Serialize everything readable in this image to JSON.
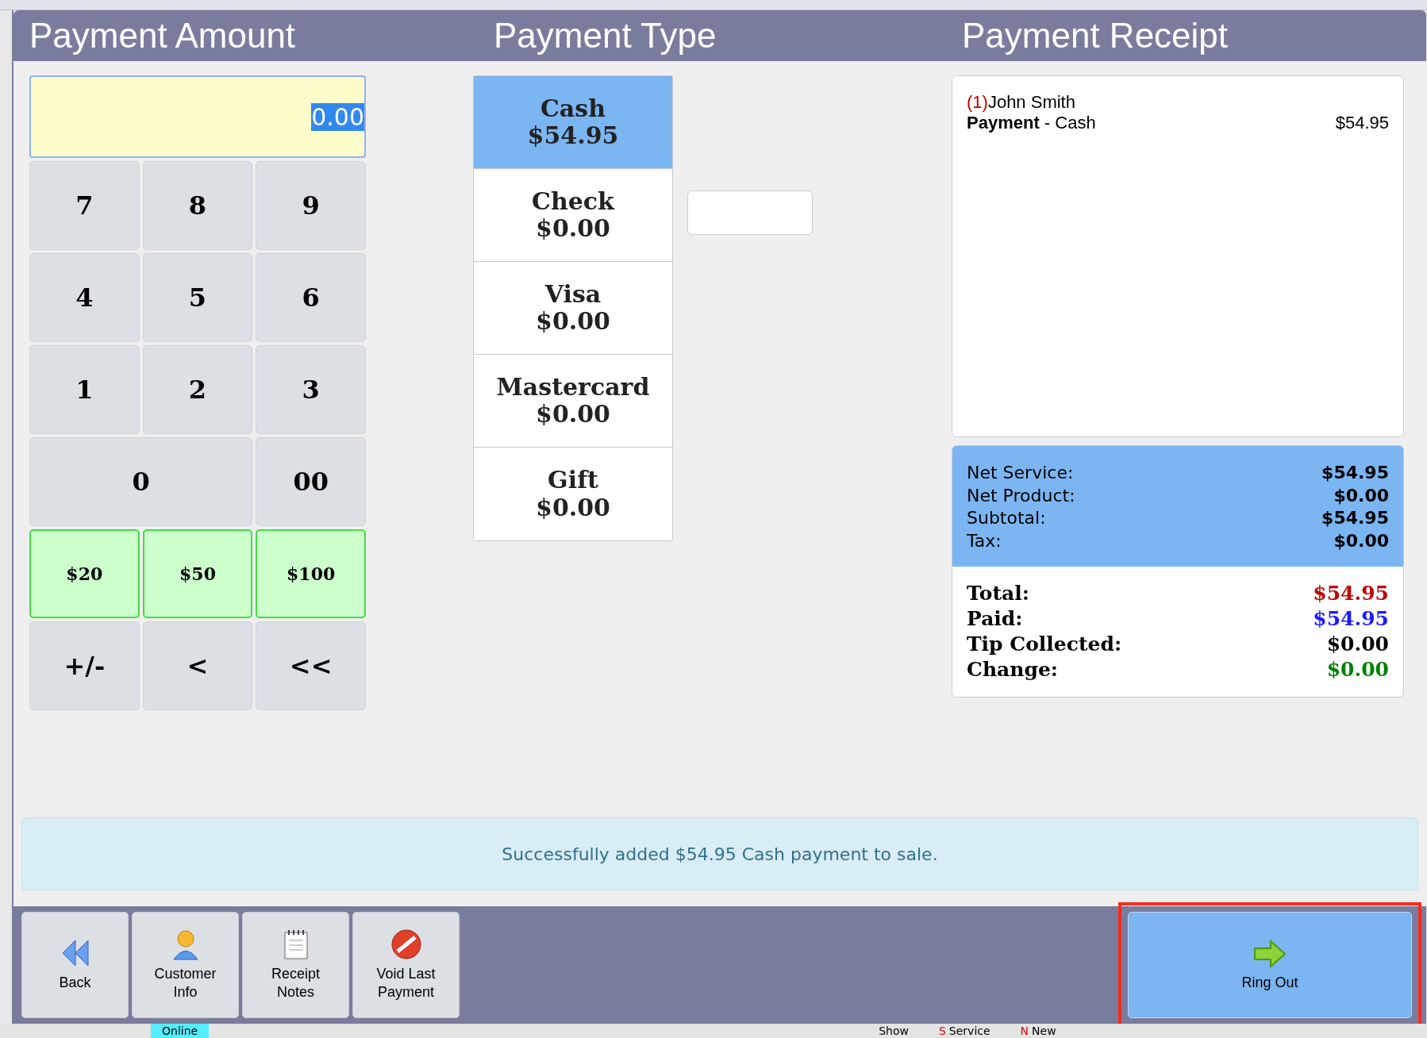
{
  "headers": [
    "Payment Amount",
    "Payment Type",
    "Payment Receipt"
  ],
  "amount": {
    "value": "0.00",
    "selected_text": true
  },
  "keypad": [
    {
      "label": "7",
      "kind": "key"
    },
    {
      "label": "8",
      "kind": "key"
    },
    {
      "label": "9",
      "kind": "key"
    },
    {
      "label": "4",
      "kind": "key"
    },
    {
      "label": "5",
      "kind": "key"
    },
    {
      "label": "6",
      "kind": "key"
    },
    {
      "label": "1",
      "kind": "key"
    },
    {
      "label": "2",
      "kind": "key"
    },
    {
      "label": "3",
      "kind": "key"
    },
    {
      "label": "0",
      "kind": "wide"
    },
    {
      "label": "00",
      "kind": "key"
    },
    {
      "label": "$20",
      "kind": "cash"
    },
    {
      "label": "$50",
      "kind": "cash"
    },
    {
      "label": "$100",
      "kind": "cash"
    },
    {
      "label": "+/-",
      "kind": "key"
    },
    {
      "label": "<",
      "kind": "key"
    },
    {
      "label": "<<",
      "kind": "key"
    }
  ],
  "payment_types": [
    {
      "name": "Cash",
      "amount": "$54.95",
      "selected": true
    },
    {
      "name": "Check",
      "amount": "$0.00",
      "selected": false
    },
    {
      "name": "Visa",
      "amount": "$0.00",
      "selected": false
    },
    {
      "name": "Mastercard",
      "amount": "$0.00",
      "selected": false
    },
    {
      "name": "Gift",
      "amount": "$0.00",
      "selected": false
    }
  ],
  "receipt": {
    "index": "(1)",
    "customer": "John Smith",
    "line": "**Payment** - Cash",
    "line_amount": "$54.95"
  },
  "subtotals": [
    {
      "label": "Net Service:",
      "value": "$54.95"
    },
    {
      "label": "Net Product:",
      "value": "$0.00"
    },
    {
      "label": "Subtotal:",
      "value": "$54.95"
    },
    {
      "label": "Tax:",
      "value": "$0.00"
    }
  ],
  "totals": [
    {
      "label": "Total:",
      "value": "$54.95",
      "color": "#c00000"
    },
    {
      "label": "Paid:",
      "value": "$54.95",
      "color": "#1a1aff"
    },
    {
      "label": "Tip Collected:",
      "value": "$0.00",
      "color": "#000000"
    },
    {
      "label": "Change:",
      "value": "$0.00",
      "color": "#008000"
    }
  ],
  "message": "Successfully added $54.95 Cash payment to sale.",
  "footer_buttons": [
    {
      "label": "Back",
      "kind": "back"
    },
    {
      "label": "Customer Info",
      "kind": "customer"
    },
    {
      "label": "Receipt Notes",
      "kind": "notes"
    },
    {
      "label": "Void Last Payment",
      "kind": "void"
    }
  ],
  "ring_out": {
    "label": "Ring Out",
    "highlighted": true
  },
  "background_items": [
    {
      "label": "Online",
      "color": "#55eeff"
    },
    {
      "label": "Show",
      "color": "#e4e4e4"
    },
    {
      "prefix": "S",
      "label": "Service",
      "color": "#e4e4e4"
    },
    {
      "prefix": "N",
      "label": "New",
      "color": "#e4e4e4"
    }
  ]
}
